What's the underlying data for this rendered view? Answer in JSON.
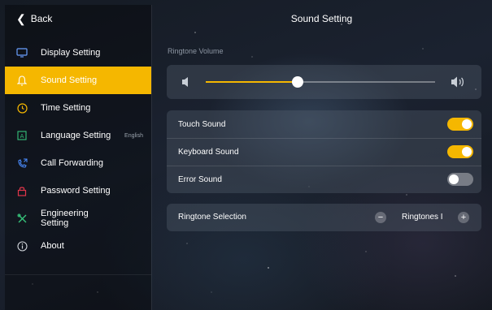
{
  "header": {
    "back_label": "Back",
    "title": "Sound Setting"
  },
  "sidebar": {
    "items": [
      {
        "label": "Display Setting",
        "icon": "monitor-icon",
        "active": false
      },
      {
        "label": "Sound Setting",
        "icon": "bell-icon",
        "active": true
      },
      {
        "label": "Time Setting",
        "icon": "clock-icon",
        "active": false
      },
      {
        "label": "Language Setting",
        "icon": "language-icon",
        "active": false,
        "sub": "English"
      },
      {
        "label": "Call Forwarding",
        "icon": "phone-forward-icon",
        "active": false
      },
      {
        "label": "Password Setting",
        "icon": "lock-icon",
        "active": false
      },
      {
        "label": "Engineering Setting",
        "icon": "tools-icon",
        "active": false
      },
      {
        "label": "About",
        "icon": "info-icon",
        "active": false
      }
    ]
  },
  "volume": {
    "label": "Ringtone Volume",
    "level_percent": 40
  },
  "toggles": [
    {
      "label": "Touch Sound",
      "on": true
    },
    {
      "label": "Keyboard Sound",
      "on": true
    },
    {
      "label": "Error Sound",
      "on": false
    }
  ],
  "ringtone": {
    "label": "Ringtone Selection",
    "value": "Ringtones I"
  },
  "colors": {
    "accent": "#f5b700",
    "sidebar_active": "#f5b700"
  }
}
